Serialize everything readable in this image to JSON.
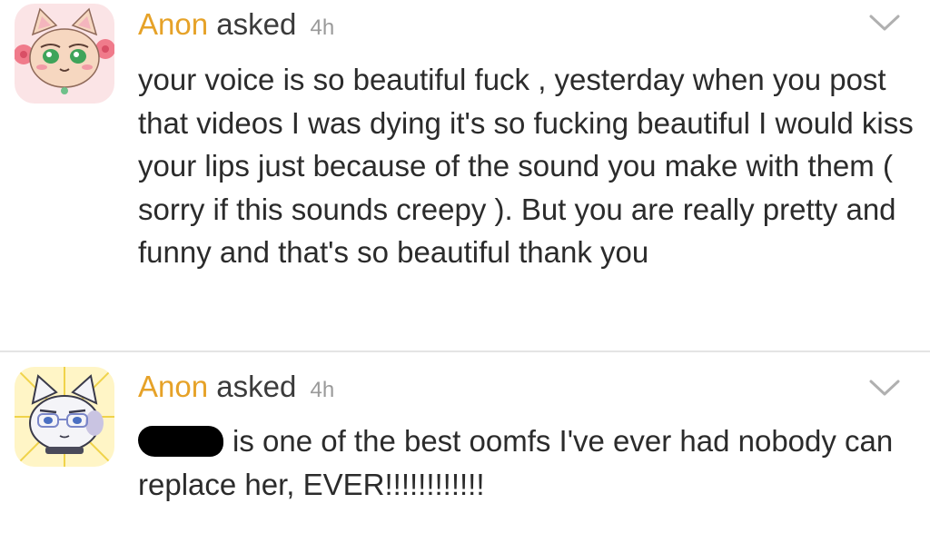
{
  "questions": [
    {
      "asker": "Anon",
      "verb": "asked",
      "time": "4h",
      "avatar_icon": "pink-cat-avatar-icon",
      "text": "your voice is so beautiful fuck , yesterday when you post that videos I was dying it's so fucking beautiful I would kiss your lips just because of the sound you make with them ( sorry if this sounds creepy ). But you are really pretty and funny and that's so beautiful thank you"
    },
    {
      "asker": "Anon",
      "verb": "asked",
      "time": "4h",
      "avatar_icon": "white-cat-avatar-icon",
      "redacted": true,
      "text": "is one of the best oomfs I've ever had nobody can replace her, EVER!!!!!!!!!!!!"
    }
  ],
  "colors": {
    "asker": "#e6a228",
    "time": "#9a9a9a",
    "divider": "#e4e4e4",
    "chevron": "#b0b0b0"
  },
  "icons": {
    "menu": "chevron-down-icon"
  }
}
